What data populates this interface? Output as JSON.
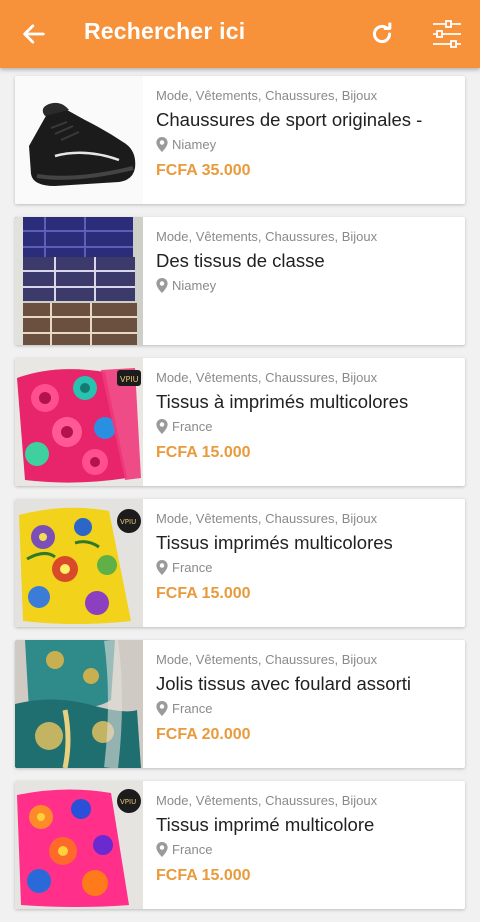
{
  "header": {
    "title": "Rechercher ici"
  },
  "colors": {
    "appbar": "#f7923a",
    "price": "#e89a3c"
  },
  "listings": [
    {
      "category": "Mode, Vêtements, Chaussures, Bijoux",
      "title": "Chaussures de sport originales -",
      "location": "Niamey",
      "price": "FCFA 35.000",
      "image": "black-sneaker"
    },
    {
      "category": "Mode, Vêtements, Chaussures, Bijoux",
      "title": "Des tissus de classe",
      "location": "Niamey",
      "price": "",
      "image": "plaid-fabrics"
    },
    {
      "category": "Mode, Vêtements, Chaussures, Bijoux",
      "title": "Tissus à imprimés multicolores",
      "location": "France",
      "price": "FCFA 15.000",
      "image": "rose-print-fabric"
    },
    {
      "category": "Mode, Vêtements, Chaussures, Bijoux",
      "title": "Tissus imprimés multicolores",
      "location": "France",
      "price": "FCFA 15.000",
      "image": "yellow-floral-fabric"
    },
    {
      "category": "Mode, Vêtements, Chaussures, Bijoux",
      "title": "Jolis tissus avec foulard assorti",
      "location": "France",
      "price": "FCFA 20.000",
      "image": "teal-gold-fabric"
    },
    {
      "category": "Mode, Vêtements, Chaussures, Bijoux",
      "title": "Tissus imprimé multicolore",
      "location": "France",
      "price": "FCFA 15.000",
      "image": "pink-floral-fabric"
    }
  ]
}
